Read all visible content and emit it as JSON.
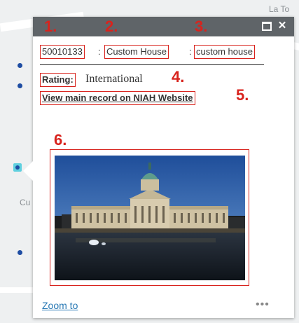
{
  "map": {
    "label_top": "La To",
    "label_side": "Cu"
  },
  "popup": {
    "steps": [
      "1.",
      "2.",
      "3.",
      "4.",
      "5.",
      "6."
    ],
    "reg_no": "50010133",
    "name": "Custom House",
    "address": "custom house",
    "separator": ":",
    "rating_label": "Rating:",
    "rating_value": "International",
    "niah_link": "View main record on NIAH Website",
    "zoom_link": "Zoom to",
    "more_icon": "•••"
  },
  "colors": {
    "annotation": "#d8231d",
    "titlebar": "#5f6468",
    "link": "#2a7ab5"
  }
}
